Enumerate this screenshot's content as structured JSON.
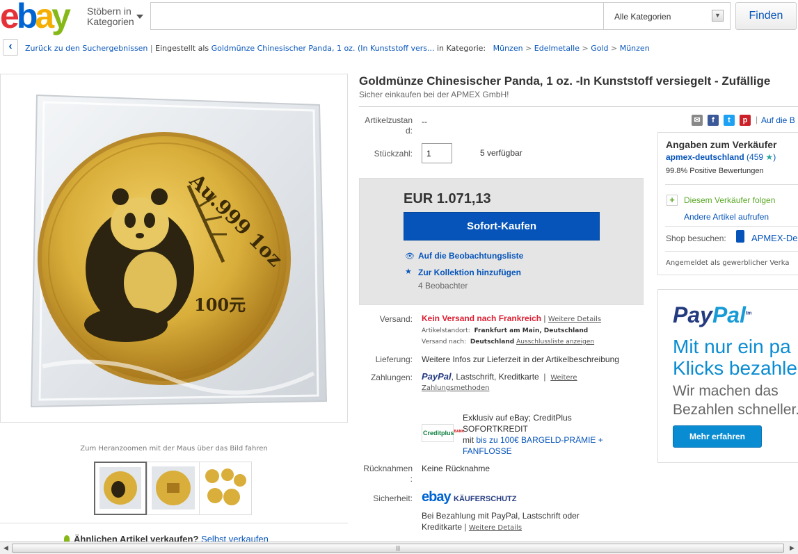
{
  "header": {
    "logo_letters": [
      "e",
      "b",
      "a",
      "y"
    ],
    "browse_line1": "Stöbern in",
    "browse_line2": "Kategorien",
    "search_value": "",
    "category": "Alle Kategorien",
    "find_label": "Finden"
  },
  "breadcrumb": {
    "back": "Zurück zu den Suchergebnissen",
    "listed_prefix": "Eingestellt als",
    "listed_title": "Goldmünze Chinesischer Panda, 1 oz. (In Kunststoff vers...",
    "category_prefix": "in Kategorie:",
    "path": [
      "Münzen",
      "Edelmetalle",
      "Gold",
      "Münzen"
    ]
  },
  "gallery": {
    "coin_text_top": "Au.999 1oz",
    "coin_text_value": "100元",
    "zoom_hint": "Zum Heranzoomen mit der Maus über das Bild fahren",
    "sell_similar": "Ähnlichen Artikel verkaufen?",
    "sell_link": "Selbst verkaufen"
  },
  "item": {
    "title": "Goldmünze Chinesischer Panda, 1 oz. -In Kunststoff versiegelt - Zufällige",
    "subtitle": "Sicher einkaufen bei der APMEX GmbH!",
    "condition_label_1": "Artikelzustan",
    "condition_label_2": "d:",
    "condition_value": "--",
    "qty_label": "Stückzahl:",
    "qty_value": "1",
    "available": "5 verfügbar",
    "share_more": "Auf die B"
  },
  "buy": {
    "price": "EUR 1.071,13",
    "buy_now": "Sofort-Kaufen",
    "watch": "Auf die Beobachtungsliste",
    "collection": "Zur Kollektion hinzufügen",
    "watchers": "4 Beobachter"
  },
  "shipping": {
    "label": "Versand:",
    "no_shipping": "Kein Versand nach Frankreich",
    "details": "Weitere Details",
    "location_label": "Artikelstandort:",
    "location_value": "Frankfurt am Main, Deutschland",
    "ships_to_label": "Versand nach:",
    "ships_to_value": "Deutschland",
    "exclusion": "Ausschlussliste anzeigen"
  },
  "delivery": {
    "label": "Lieferung:",
    "value": "Weitere Infos zur Lieferzeit in der Artikelbeschreibung"
  },
  "payment": {
    "label": "Zahlungen:",
    "paypal_pay": "PayPal",
    "methods": "Lastschrift,   Kreditkarte",
    "more_1": "Weitere",
    "more_2": "Zahlungsmethoden",
    "credit_logo": "Creditplus",
    "credit_logo_sup": "BANK",
    "credit_line1": "Exklusiv auf eBay; CreditPlus",
    "credit_line2": "SOFORTKREDIT",
    "credit_mit": "mit",
    "credit_promo_1": "bis zu 100€ BARGELD-PRÄMIE +",
    "credit_promo_2": "FANFLOSSE"
  },
  "returns": {
    "label_1": "Rücknahmen",
    "label_2": ":",
    "value": "Keine Rücknahme"
  },
  "security": {
    "label": "Sicherheit:",
    "logo_ebay": "ebay",
    "protection": "KÄUFERSCHUTZ",
    "text_1": "Bei Bezahlung mit PayPal, Lastschrift oder",
    "text_2": "Kreditkarte",
    "details": "Weitere Details"
  },
  "seller": {
    "heading": "Angaben zum Verkäufer",
    "name": "apmex-deutschland",
    "score": "(459",
    "score_close": ")",
    "positive": "99.8% Positive Bewertungen",
    "follow": "Diesem Verkäufer folgen",
    "other_items": "Andere Artikel aufrufen",
    "shop_label": "Shop besuchen:",
    "shop_name": "APMEX-De",
    "registered": "Angemeldet als gewerblicher Verka"
  },
  "paypal_ad": {
    "logo_pay": "Pay",
    "logo_pal": "Pal",
    "tm": "tm",
    "headline_1": "Mit nur ein pa",
    "headline_2": "Klicks bezahle",
    "sub_1": "Wir machen das",
    "sub_2": "Bezahlen schneller.",
    "button": "Mehr erfahren"
  },
  "colors": {
    "link": "#0654ba",
    "buy_button": "#0654ba",
    "alert": "#dd1e31",
    "paypal_blue": "#0a8cd2"
  }
}
